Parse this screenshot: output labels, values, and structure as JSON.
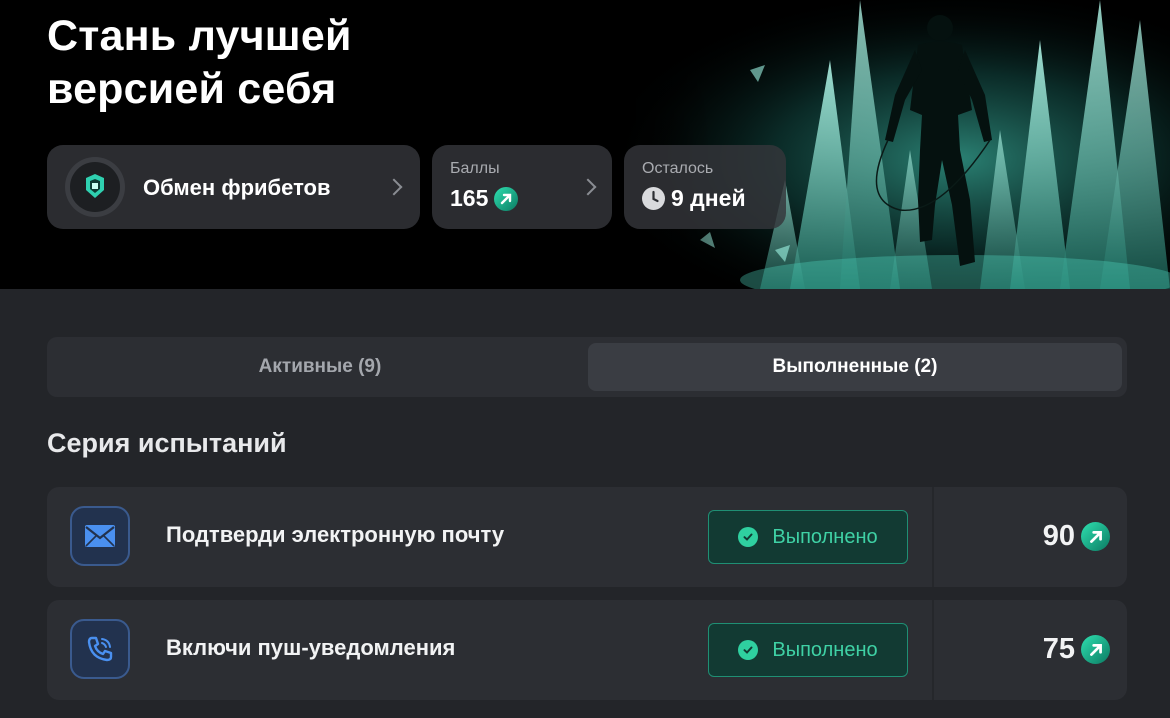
{
  "hero": {
    "title_line1": "Стань лучшей",
    "title_line2": "версией себя"
  },
  "cards": {
    "exchange": {
      "label": "Обмен фрибетов",
      "icon": "freebet-avatar-icon"
    },
    "points": {
      "label": "Баллы",
      "value": "165",
      "icon": "coin-arrow-icon"
    },
    "remaining": {
      "label": "Осталось",
      "value": "9 дней",
      "icon": "clock-icon"
    }
  },
  "tabs": {
    "active": "Активные (9)",
    "completed": "Выполненные (2)",
    "selected": "completed"
  },
  "section": {
    "title": "Серия испытаний"
  },
  "tasks": [
    {
      "title": "Подтверди электронную почту",
      "status": "Выполнено",
      "points": "90",
      "icon": "mail-icon"
    },
    {
      "title": "Включи пуш-уведомления",
      "status": "Выполнено",
      "points": "75",
      "icon": "phone-icon"
    }
  ],
  "colors": {
    "accent": "#2fd0a0",
    "background": "#232529",
    "card": "#2c2e33",
    "status_bg": "#123a33"
  }
}
